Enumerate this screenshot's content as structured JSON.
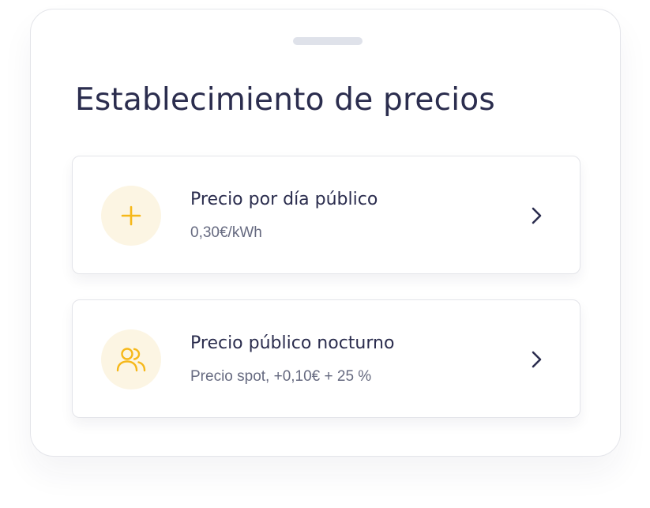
{
  "sheet": {
    "title": "Establecimiento de precios"
  },
  "pricing_options": [
    {
      "title": "Precio por día público",
      "subtitle": "0,30€/kWh",
      "icon": "plus-icon"
    },
    {
      "title": "Precio público nocturno",
      "subtitle": "Precio spot, +0,10€ + 25 %",
      "icon": "users-icon"
    }
  ],
  "colors": {
    "accent": "#f6b81a",
    "icon_background": "#fcf5e3",
    "text_primary": "#2b2d4e",
    "text_secondary": "#666a80"
  }
}
